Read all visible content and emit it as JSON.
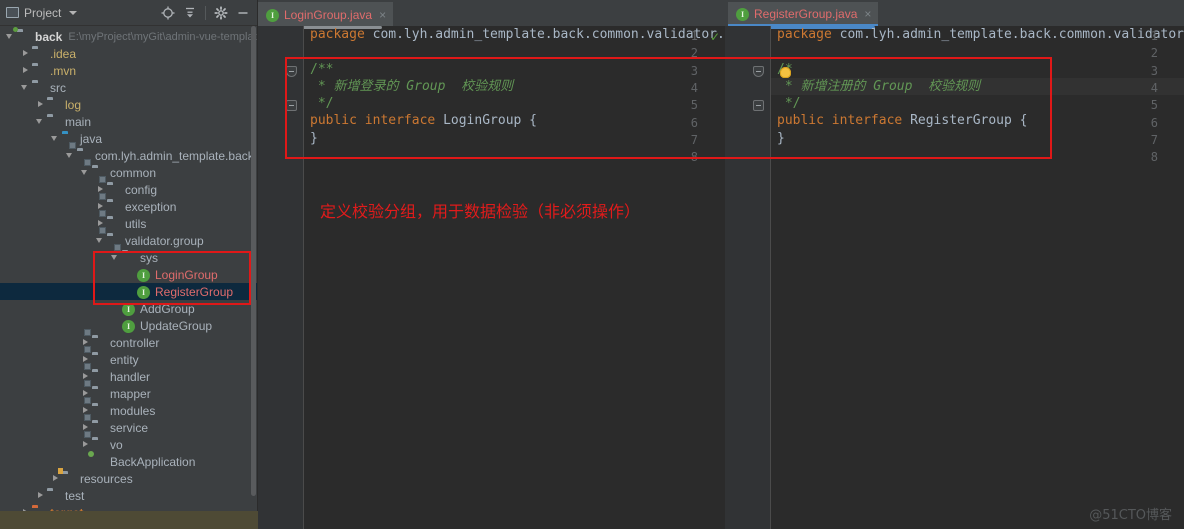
{
  "window": {
    "watermark": "@51CTO博客"
  },
  "project_panel": {
    "title": "Project",
    "title_icon": "project-view-icon",
    "toolbar": [
      {
        "name": "locate-in-tree-icon",
        "label": "Select Opened File"
      },
      {
        "name": "collapse-all-icon",
        "label": "Collapse All"
      },
      {
        "name": "gear-icon",
        "label": "Settings"
      },
      {
        "name": "minimize-icon",
        "label": "Hide"
      }
    ],
    "tree": [
      {
        "indent": 0,
        "arrow": "down",
        "icon": "module-folder-icon",
        "label": "back",
        "style": "bold",
        "hint": "E:\\myProject\\myGit\\admin-vue-template"
      },
      {
        "indent": 1,
        "arrow": "right",
        "icon": "folder-icon",
        "label": ".idea",
        "style": "yellowish"
      },
      {
        "indent": 1,
        "arrow": "right",
        "icon": "folder-icon",
        "label": ".mvn",
        "style": "yellowish"
      },
      {
        "indent": 1,
        "arrow": "down",
        "icon": "folder-icon",
        "label": "src"
      },
      {
        "indent": 2,
        "arrow": "right",
        "icon": "folder-icon",
        "label": "log",
        "style": "yellowish"
      },
      {
        "indent": 2,
        "arrow": "down",
        "icon": "folder-icon",
        "label": "main"
      },
      {
        "indent": 3,
        "arrow": "down",
        "icon": "source-folder-icon",
        "label": "java"
      },
      {
        "indent": 4,
        "arrow": "down",
        "icon": "package-icon",
        "label": "com.lyh.admin_template.back"
      },
      {
        "indent": 5,
        "arrow": "down",
        "icon": "package-icon",
        "label": "common"
      },
      {
        "indent": 6,
        "arrow": "right",
        "icon": "package-icon",
        "label": "config"
      },
      {
        "indent": 6,
        "arrow": "right",
        "icon": "package-icon",
        "label": "exception"
      },
      {
        "indent": 6,
        "arrow": "right",
        "icon": "package-icon",
        "label": "utils"
      },
      {
        "indent": 6,
        "arrow": "down",
        "icon": "package-icon",
        "label": "validator.group"
      },
      {
        "indent": 7,
        "arrow": "down",
        "icon": "package-icon",
        "label": "sys"
      },
      {
        "indent": 8,
        "arrow": "none",
        "icon": "interface-icon",
        "label": "LoginGroup",
        "style": "red"
      },
      {
        "indent": 8,
        "arrow": "none",
        "icon": "interface-icon",
        "label": "RegisterGroup",
        "style": "red",
        "selected": true
      },
      {
        "indent": 7,
        "arrow": "none",
        "icon": "interface-icon",
        "label": "AddGroup"
      },
      {
        "indent": 7,
        "arrow": "none",
        "icon": "interface-icon",
        "label": "UpdateGroup"
      },
      {
        "indent": 5,
        "arrow": "right",
        "icon": "package-icon",
        "label": "controller"
      },
      {
        "indent": 5,
        "arrow": "right",
        "icon": "package-icon",
        "label": "entity"
      },
      {
        "indent": 5,
        "arrow": "right",
        "icon": "package-icon",
        "label": "handler"
      },
      {
        "indent": 5,
        "arrow": "right",
        "icon": "package-icon",
        "label": "mapper"
      },
      {
        "indent": 5,
        "arrow": "right",
        "icon": "package-icon",
        "label": "modules"
      },
      {
        "indent": 5,
        "arrow": "right",
        "icon": "package-icon",
        "label": "service"
      },
      {
        "indent": 5,
        "arrow": "right",
        "icon": "package-icon",
        "label": "vo"
      },
      {
        "indent": 5,
        "arrow": "none",
        "icon": "spring-boot-icon",
        "label": "BackApplication"
      },
      {
        "indent": 3,
        "arrow": "right",
        "icon": "resources-folder-icon",
        "label": "resources"
      },
      {
        "indent": 2,
        "arrow": "right",
        "icon": "folder-icon",
        "label": "test"
      },
      {
        "indent": 1,
        "arrow": "right",
        "icon": "excluded-folder-icon",
        "label": "target",
        "style": "orange"
      }
    ]
  },
  "editor": {
    "tabs": [
      {
        "label": "LoginGroup.java",
        "icon": "interface-icon",
        "active": false,
        "close": "×"
      },
      {
        "label": "RegisterGroup.java",
        "icon": "interface-icon",
        "active": true,
        "close": "×"
      }
    ],
    "left_pane": {
      "file": "LoginGroup.java",
      "line_numbers": [
        "1",
        "2",
        "3",
        "4",
        "5",
        "6",
        "7",
        "8"
      ],
      "lines": [
        {
          "no": "1",
          "segments": [
            {
              "t": "package ",
              "c": "kw"
            },
            {
              "t": "com.lyh.admin_template.back.common.validator.",
              "c": "plain"
            }
          ]
        },
        {
          "no": "2",
          "segments": []
        },
        {
          "no": "3",
          "segments": [
            {
              "t": "/**",
              "c": "cmt"
            }
          ],
          "fold": "top"
        },
        {
          "no": "4",
          "segments": [
            {
              "t": " * ",
              "c": "cmt"
            },
            {
              "t": "新增登录的 Group  校验规则",
              "c": "cmt-i"
            }
          ]
        },
        {
          "no": "5",
          "segments": [
            {
              "t": " */",
              "c": "cmt"
            }
          ],
          "fold": "bottom"
        },
        {
          "no": "6",
          "segments": [
            {
              "t": "public ",
              "c": "kw"
            },
            {
              "t": "interface ",
              "c": "kw"
            },
            {
              "t": "LoginGroup ",
              "c": "cls"
            },
            {
              "t": "{",
              "c": "brace"
            }
          ]
        },
        {
          "no": "7",
          "segments": [
            {
              "t": "}",
              "c": "brace"
            }
          ]
        },
        {
          "no": "8",
          "segments": []
        }
      ],
      "inspection_badge": "ok-check-icon"
    },
    "right_pane": {
      "file": "RegisterGroup.java",
      "line_numbers": [
        "1",
        "2",
        "3",
        "4",
        "5",
        "6",
        "7",
        "8"
      ],
      "lines": [
        {
          "no": "1",
          "segments": [
            {
              "t": "package ",
              "c": "kw"
            },
            {
              "t": "com.lyh.admin_template.back.common.validator",
              "c": "plain"
            }
          ]
        },
        {
          "no": "2",
          "segments": []
        },
        {
          "no": "3",
          "segments": [
            {
              "t": "/",
              "c": "cmt"
            },
            {
              "t": "*",
              "c": "cmt"
            }
          ],
          "fold": "top",
          "bulb": true
        },
        {
          "no": "4",
          "segments": [
            {
              "t": " * ",
              "c": "cmt"
            },
            {
              "t": "新增注册的 Group  校验规则",
              "c": "cmt-i"
            }
          ],
          "current": true
        },
        {
          "no": "5",
          "segments": [
            {
              "t": " */",
              "c": "cmt"
            }
          ],
          "fold": "bottom"
        },
        {
          "no": "6",
          "segments": [
            {
              "t": "public ",
              "c": "kw"
            },
            {
              "t": "interface ",
              "c": "kw"
            },
            {
              "t": "RegisterGroup ",
              "c": "cls"
            },
            {
              "t": "{",
              "c": "brace"
            }
          ]
        },
        {
          "no": "7",
          "segments": [
            {
              "t": "}",
              "c": "brace"
            }
          ]
        },
        {
          "no": "8",
          "segments": []
        }
      ]
    },
    "annotation": "定义校验分组，用于数据检验（非必须操作）"
  },
  "colors": {
    "annotation_red": "#e21b1b",
    "box_red": "#e01818",
    "selection_blue": "#0d293e",
    "tab_underline": "#4a88c7",
    "panel_bg": "#3c3f41",
    "editor_bg": "#2b2b2b",
    "gutter_bg": "#313335",
    "comment_green": "#629755",
    "keyword_orange": "#cc7832"
  }
}
